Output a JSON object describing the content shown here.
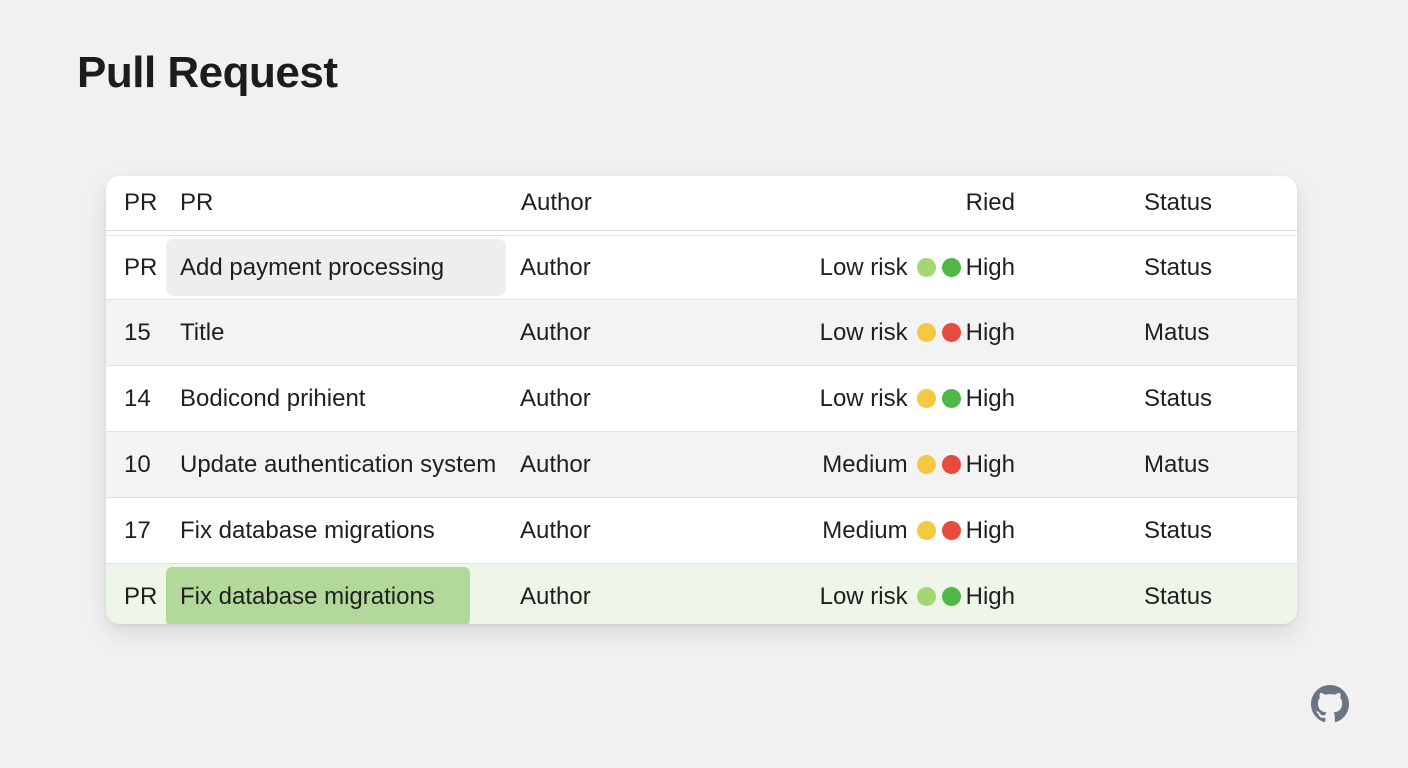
{
  "page": {
    "title": "Pull Request"
  },
  "table": {
    "headers": {
      "num": "PR",
      "title": "PR",
      "author": "Author",
      "risk": "Ried",
      "status": "Status"
    },
    "rows": [
      {
        "num": "PR",
        "title": "Add payment processing",
        "author": "Author",
        "risk_left": "Low risk",
        "dot_left_color": "#a6d672",
        "dot_right_color": "#4fb849",
        "risk_right": "High",
        "status": "Status"
      },
      {
        "num": "15",
        "title": "Title",
        "author": "Author",
        "risk_left": "Low risk",
        "dot_left_color": "#f5c842",
        "dot_right_color": "#e84a3f",
        "risk_right": "High",
        "status": "Matus"
      },
      {
        "num": "14",
        "title": "Bodicond prihient",
        "author": "Author",
        "risk_left": "Low risk",
        "dot_left_color": "#f5c842",
        "dot_right_color": "#4fb849",
        "risk_right": "High",
        "status": "Status"
      },
      {
        "num": "10",
        "title": "Update authentication system",
        "author": "Author",
        "risk_left": "Medium",
        "dot_left_color": "#f5c842",
        "dot_right_color": "#e84a3f",
        "risk_right": "High",
        "status": "Matus"
      },
      {
        "num": "17",
        "title": "Fix database migrations",
        "author": "Author",
        "risk_left": "Medium",
        "dot_left_color": "#f5c842",
        "dot_right_color": "#e84a3f",
        "risk_right": "High",
        "status": "Status"
      },
      {
        "num": "PR",
        "title": "Fix database migrations",
        "author": "Author",
        "risk_left": "Low risk",
        "dot_left_color": "#a6d672",
        "dot_right_color": "#4fb849",
        "risk_right": "High",
        "status": "Status"
      }
    ]
  },
  "footer": {
    "icon": "github-icon"
  }
}
